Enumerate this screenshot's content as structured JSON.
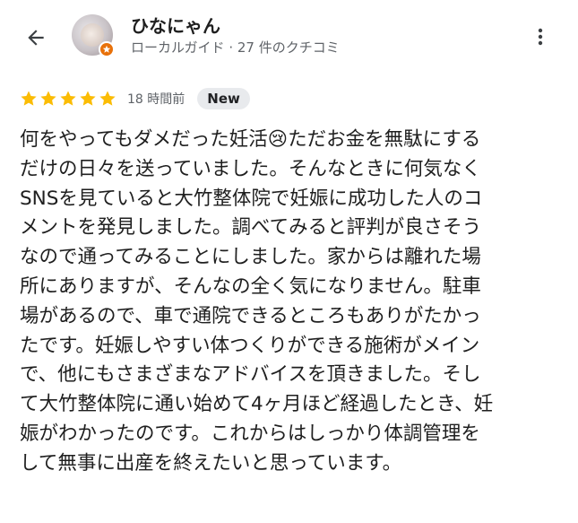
{
  "header": {
    "back_icon": "arrow-left-icon",
    "user_name": "ひなにゃん",
    "user_meta": "ローカルガイド · 27 件のクチコミ",
    "more_icon": "more-vert-icon"
  },
  "review": {
    "rating": 5,
    "rating_max": 5,
    "time": "18 時間前",
    "badge": "New",
    "star_color": "#fbbc04",
    "lines": [
      "何をやってもダメだった妊活😢ただお金を無駄にする",
      "だけの日々を送っていました。そんなときに何気なく",
      "SNSを見ていると大竹整体院で妊娠に成功した人のコ",
      "メントを発見しました。調べてみると評判が良さそう",
      "なので通ってみることにしました。家からは離れた場",
      "所にありますが、そんなの全く気になりません。駐車",
      "場があるので、車で通院できるところもありがたかっ",
      "たです。妊娠しやすい体つくりができる施術がメイン",
      "で、他にもさまざまなアドバイスを頂きました。そし",
      "て大竹整体院に通い始めて4ヶ月ほど経過したとき、妊",
      "娠がわかったのです。これからはしっかり体調管理を",
      "して無事に出産を終えたいと思っています。"
    ]
  },
  "colors": {
    "guide_badge": "#e8710a",
    "meta_text": "#5f6368",
    "badge_bg": "#e8eaed"
  }
}
